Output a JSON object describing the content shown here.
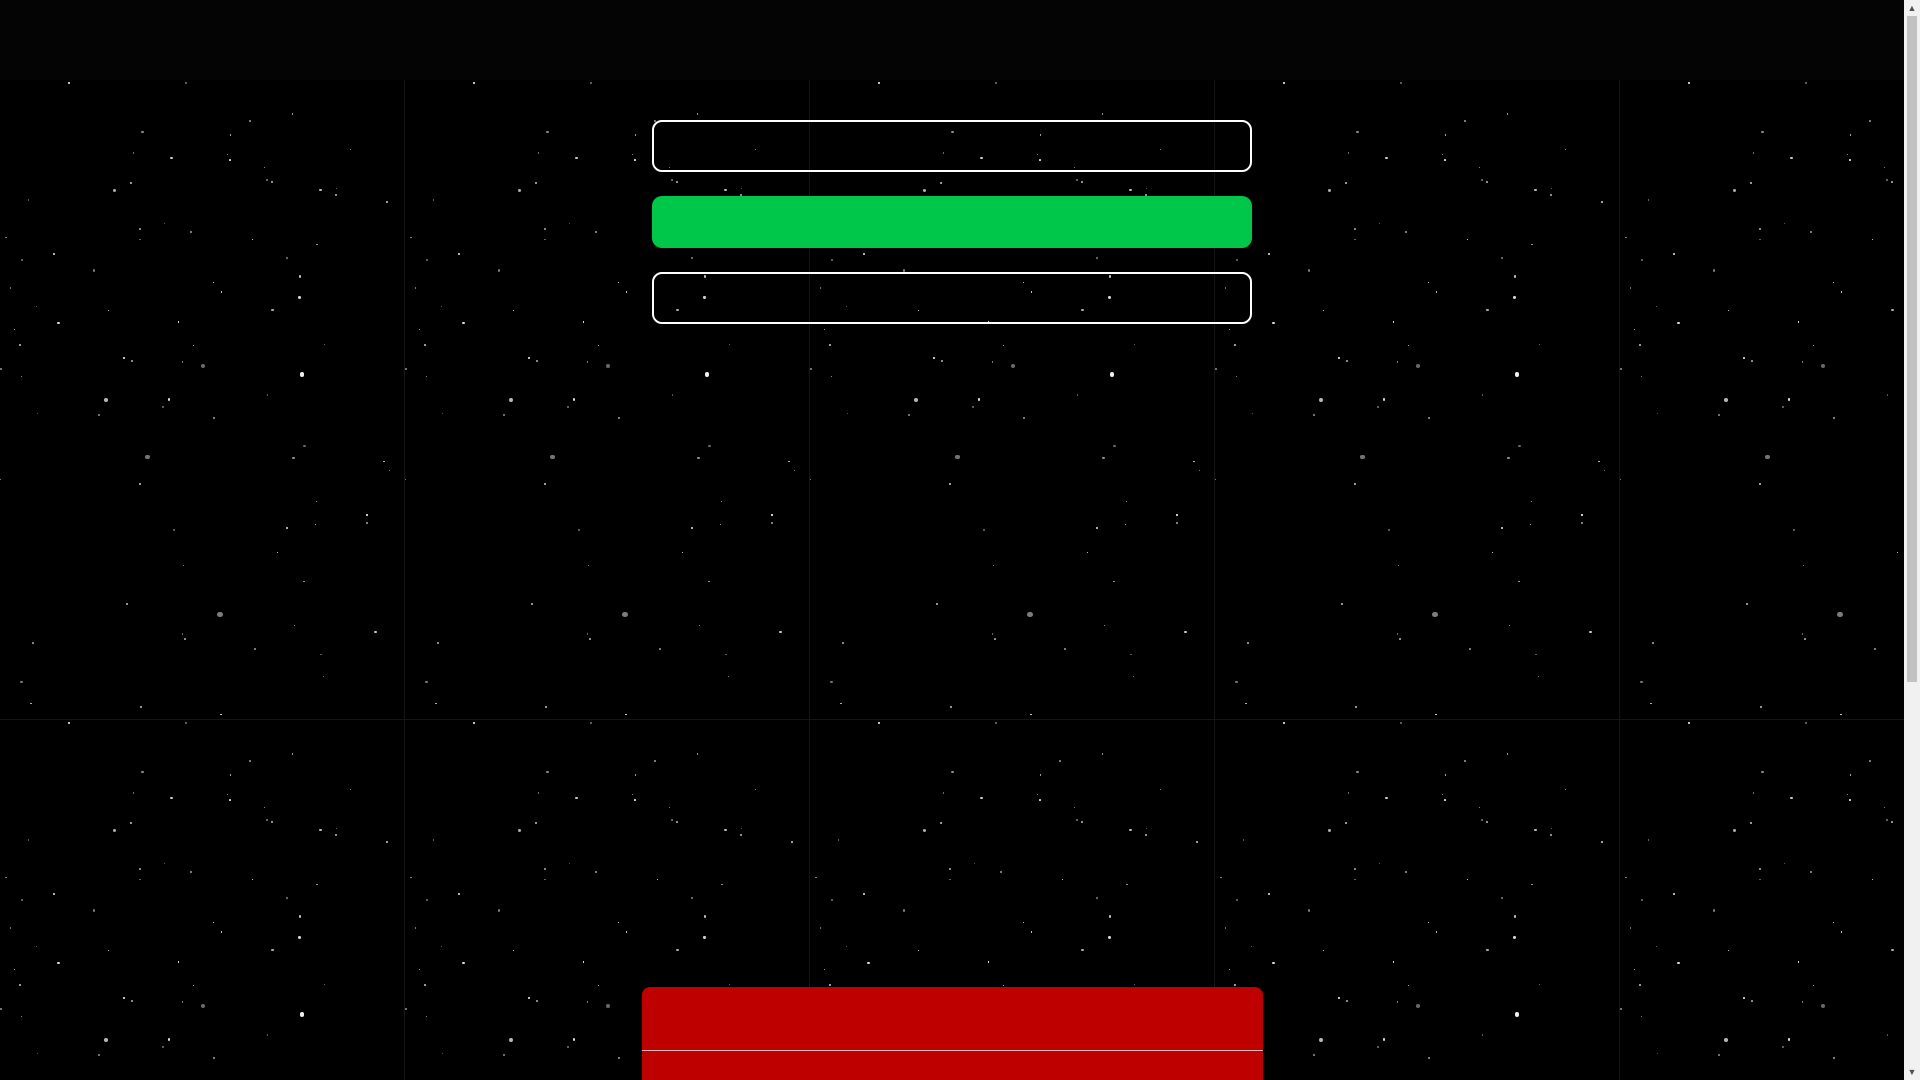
{
  "page": {
    "background_color": "#000000",
    "star_color": "#ffffff"
  },
  "buttons": {
    "top_outline_label": "",
    "green_label": "",
    "bottom_outline_label": "",
    "green_color": "#00c64a",
    "outline_color": "#ffffff"
  },
  "panel": {
    "color": "#be0000",
    "label": ""
  },
  "scrollbar": {
    "up_icon": "chevron-up-icon",
    "down_icon": "chevron-down-icon"
  }
}
